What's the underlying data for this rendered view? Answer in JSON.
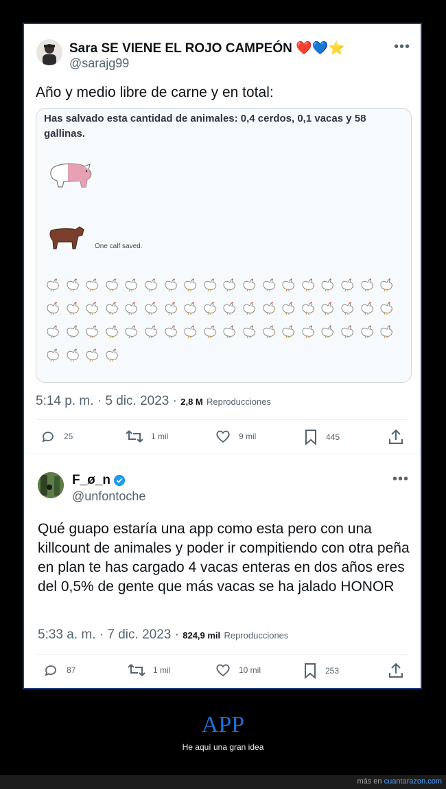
{
  "tweet1": {
    "name": "Sara SE VIENE EL ROJO CAMPEÓN ❤️💙⭐",
    "handle": "@sarajg99",
    "text": "Año y medio libre de carne y en total:",
    "embed": {
      "title": "Has salvado esta cantidad de animales: 0,4 cerdos, 0,1 vacas y 58 gallinas.",
      "calf_note": "One calf saved.",
      "chicken_count": 58
    },
    "time": "5:14 p. m. · 5 dic. 2023 ·",
    "views": "2,8 M",
    "views_label": "Reproducciones",
    "replies": "25",
    "retweets": "1 mil",
    "likes": "9 mil",
    "bookmarks": "445"
  },
  "tweet2": {
    "name": "F_ø_n",
    "handle": "@unfontoche",
    "text": "Qué guapo estaría una app como esta pero con una killcount de animales y poder ir compitiendo con otra peña en plan te has cargado 4 vacas enteras en dos años eres del 0,5% de gente que más vacas se ha jalado HONOR",
    "time": "5:33 a. m. · 7 dic. 2023 ·",
    "views": "824,9 mil",
    "views_label": "Reproducciones",
    "replies": "87",
    "retweets": "1 mil",
    "likes": "10 mil",
    "bookmarks": "253"
  },
  "footer": {
    "title": "APP",
    "subtitle": "He aquí una gran idea",
    "brand_prefix": "más en",
    "brand_link": "cuantarazon.com"
  },
  "colors": {
    "accent": "#1d9bf0",
    "footer_title": "#1e6fd9",
    "card_border": "#1d3f7a"
  },
  "icons": [
    "reply-icon",
    "retweet-icon",
    "like-icon",
    "bookmark-icon",
    "share-icon",
    "verified-icon",
    "more-icon",
    "pig-icon",
    "calf-icon",
    "chicken-icon"
  ]
}
